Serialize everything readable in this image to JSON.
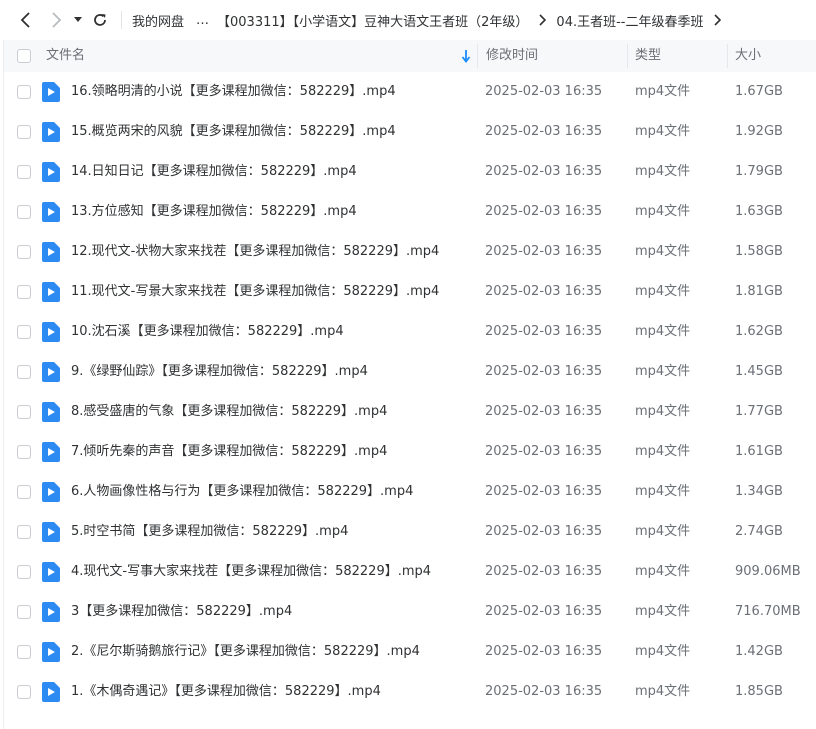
{
  "nav": {
    "crumbs": [
      "我的网盘",
      "…",
      "【003311】【小学语文】豆神大语文王者班（2年级）",
      "04.王者班--二年级春季班"
    ]
  },
  "header": {
    "name": "文件名",
    "time": "修改时间",
    "type": "类型",
    "size": "大小"
  },
  "colors": {
    "accent": "#1a8cff",
    "file_icon": "#2b8bf2"
  },
  "files": [
    {
      "name": "16.领略明清的小说【更多课程加微信：582229】.mp4",
      "time": "2025-02-03 16:35",
      "type": "mp4文件",
      "size": "1.67GB"
    },
    {
      "name": "15.概览两宋的风貌【更多课程加微信：582229】.mp4",
      "time": "2025-02-03 16:35",
      "type": "mp4文件",
      "size": "1.92GB"
    },
    {
      "name": "14.日知日记【更多课程加微信：582229】.mp4",
      "time": "2025-02-03 16:35",
      "type": "mp4文件",
      "size": "1.79GB"
    },
    {
      "name": "13.方位感知【更多课程加微信：582229】.mp4",
      "time": "2025-02-03 16:35",
      "type": "mp4文件",
      "size": "1.63GB"
    },
    {
      "name": "12.现代文-状物大家来找茬【更多课程加微信：582229】.mp4",
      "time": "2025-02-03 16:35",
      "type": "mp4文件",
      "size": "1.58GB"
    },
    {
      "name": "11.现代文-写景大家来找茬【更多课程加微信：582229】.mp4",
      "time": "2025-02-03 16:35",
      "type": "mp4文件",
      "size": "1.81GB"
    },
    {
      "name": "10.沈石溪【更多课程加微信：582229】.mp4",
      "time": "2025-02-03 16:35",
      "type": "mp4文件",
      "size": "1.62GB"
    },
    {
      "name": "9.《绿野仙踪》【更多课程加微信：582229】.mp4",
      "time": "2025-02-03 16:35",
      "type": "mp4文件",
      "size": "1.45GB"
    },
    {
      "name": "8.感受盛唐的气象【更多课程加微信：582229】.mp4",
      "time": "2025-02-03 16:35",
      "type": "mp4文件",
      "size": "1.77GB"
    },
    {
      "name": "7.倾听先秦的声音【更多课程加微信：582229】.mp4",
      "time": "2025-02-03 16:35",
      "type": "mp4文件",
      "size": "1.61GB"
    },
    {
      "name": "6.人物画像性格与行为【更多课程加微信：582229】.mp4",
      "time": "2025-02-03 16:35",
      "type": "mp4文件",
      "size": "1.34GB"
    },
    {
      "name": "5.时空书简【更多课程加微信：582229】.mp4",
      "time": "2025-02-03 16:35",
      "type": "mp4文件",
      "size": "2.74GB"
    },
    {
      "name": "4.现代文-写事大家来找茬【更多课程加微信：582229】.mp4",
      "time": "2025-02-03 16:35",
      "type": "mp4文件",
      "size": "909.06MB"
    },
    {
      "name": "3【更多课程加微信：582229】.mp4",
      "time": "2025-02-03 16:35",
      "type": "mp4文件",
      "size": "716.70MB"
    },
    {
      "name": "2.《尼尔斯骑鹅旅行记》【更多课程加微信：582229】.mp4",
      "time": "2025-02-03 16:35",
      "type": "mp4文件",
      "size": "1.42GB"
    },
    {
      "name": "1.《木偶奇遇记》【更多课程加微信：582229】.mp4",
      "time": "2025-02-03 16:35",
      "type": "mp4文件",
      "size": "1.85GB"
    }
  ]
}
